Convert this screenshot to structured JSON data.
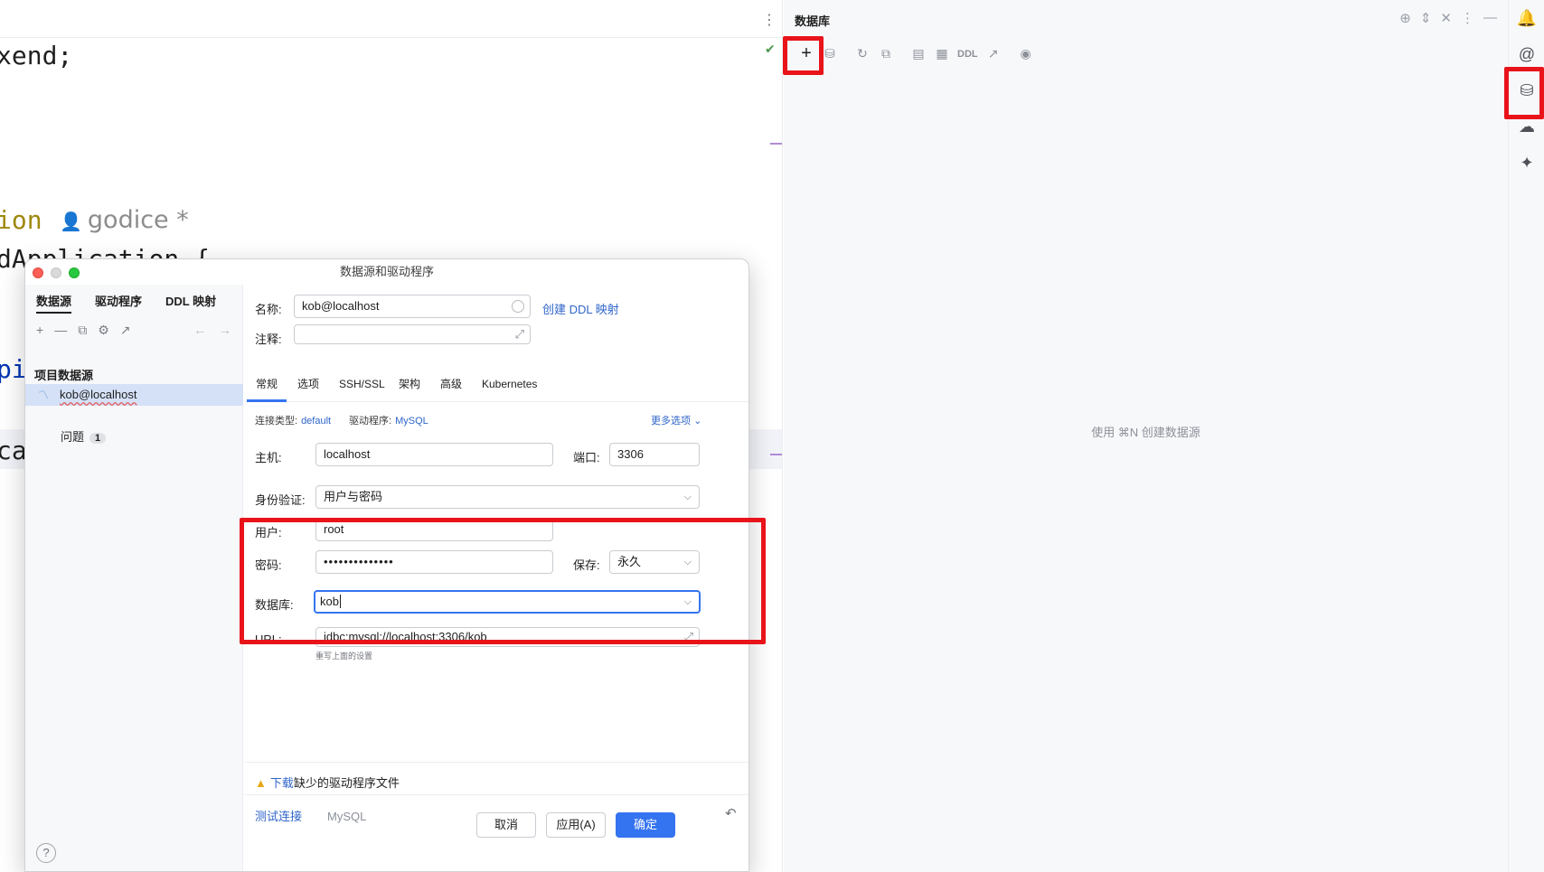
{
  "editor": {
    "code_lines": [
      "xend;",
      "ion",
      "dApplication {",
      "pi",
      "ca"
    ],
    "author": "godice *"
  },
  "db_panel": {
    "title": "数据库",
    "toolbar": {
      "add": "+",
      "ddl": "DDL"
    },
    "empty_hint": "使用 ⌘N 创建数据源"
  },
  "dialog": {
    "title": "数据源和驱动程序",
    "sidebar": {
      "tabs": [
        "数据源",
        "驱动程序",
        "DDL 映射"
      ],
      "section_label": "项目数据源",
      "item": "kob@localhost",
      "issues_label": "问题",
      "issues_count": "1"
    },
    "form": {
      "name_label": "名称:",
      "name_value": "kob@localhost",
      "create_ddl_link": "创建 DDL 映射",
      "comment_label": "注释:",
      "comment_value": "",
      "tabs": [
        "常规",
        "选项",
        "SSH/SSL",
        "架构",
        "高级",
        "Kubernetes"
      ],
      "conn_type_label": "连接类型:",
      "conn_type_value": "default",
      "driver_label": "驱动程序:",
      "driver_value": "MySQL",
      "more_options": "更多选项",
      "host_label": "主机:",
      "host_value": "localhost",
      "port_label": "端口:",
      "port_value": "3306",
      "auth_label": "身份验证:",
      "auth_value": "用户与密码",
      "user_label": "用户:",
      "user_value": "root",
      "password_label": "密码:",
      "password_value": "••••••••••••••",
      "save_label": "保存:",
      "save_value": "永久",
      "database_label": "数据库:",
      "database_value": "kob",
      "url_label": "URL:",
      "url_prefix": "jdbc:mysql://localhost:3306/",
      "url_db": "kob",
      "url_hint": "重写上面的设置",
      "warn_link": "下载",
      "warn_text": "缺少的驱动程序文件",
      "test_link": "测试连接",
      "driver_name": "MySQL"
    },
    "buttons": {
      "cancel": "取消",
      "apply": "应用(A)",
      "ok": "确定"
    }
  },
  "colors": {
    "accent": "#3574f0",
    "highlight_red": "#e8141a",
    "link": "#2f65ca"
  }
}
